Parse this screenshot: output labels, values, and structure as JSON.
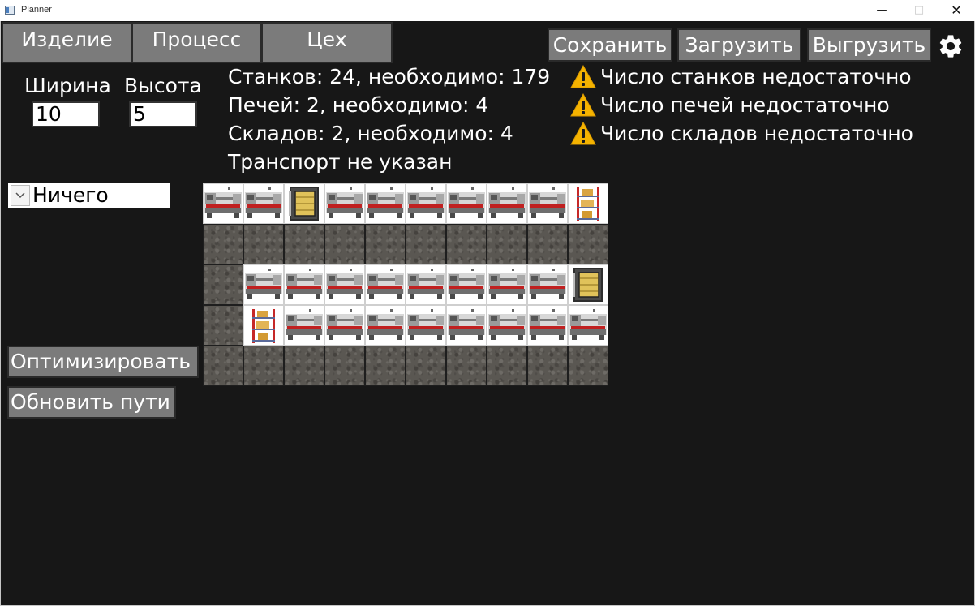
{
  "window": {
    "title": "Planner"
  },
  "tabs": [
    "Изделие",
    "Процесс",
    "Цех"
  ],
  "toolbar": {
    "save_label": "Сохранить",
    "load_label": "Загрузить",
    "export_label": "Выгрузить",
    "settings_icon": "gear-icon"
  },
  "dimensions": {
    "width_label": "Ширина",
    "width_value": "10",
    "height_label": "Высота",
    "height_value": "5"
  },
  "status": {
    "machines": "Станков: 24, необходимо: 179",
    "furnaces": "Печей: 2, необходимо: 4",
    "warehouses": "Складов: 2, необходимо: 4",
    "transport": "Транспорт не указан"
  },
  "warnings": [
    "Число станков недостаточно",
    "Число печей недостаточно",
    "Число складов недостаточно"
  ],
  "warning_color": "#f5b300",
  "object_select": {
    "value": "Ничего"
  },
  "actions": {
    "optimize_label": "Оптимизировать",
    "update_paths_label": "Обновить пути"
  },
  "layout_grid": {
    "columns": 10,
    "rows": 5,
    "legend": {
      "L": "lathe",
      "F": "furnace",
      "S": "storage-rack",
      "E": "floor"
    },
    "cells": [
      [
        "L",
        "L",
        "F",
        "L",
        "L",
        "L",
        "L",
        "L",
        "L",
        "S"
      ],
      [
        "E",
        "E",
        "E",
        "E",
        "E",
        "E",
        "E",
        "E",
        "E",
        "E"
      ],
      [
        "E",
        "L",
        "L",
        "L",
        "L",
        "L",
        "L",
        "L",
        "L",
        "F"
      ],
      [
        "E",
        "S",
        "L",
        "L",
        "L",
        "L",
        "L",
        "L",
        "L",
        "L"
      ],
      [
        "E",
        "E",
        "E",
        "E",
        "E",
        "E",
        "E",
        "E",
        "E",
        "E"
      ]
    ]
  }
}
